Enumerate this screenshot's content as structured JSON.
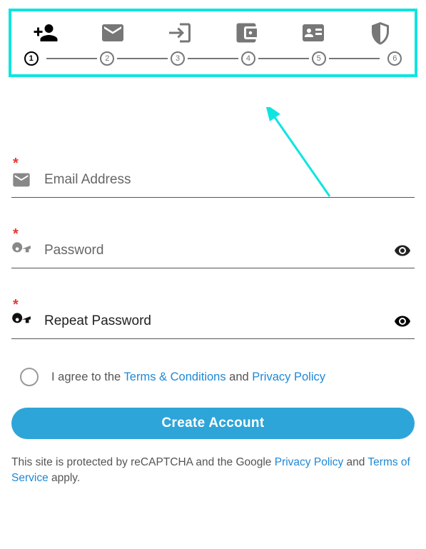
{
  "stepper": {
    "steps": [
      {
        "num": "1",
        "icon": "person-add-icon",
        "active": true
      },
      {
        "num": "2",
        "icon": "mail-icon",
        "active": false
      },
      {
        "num": "3",
        "icon": "login-icon",
        "active": false
      },
      {
        "num": "4",
        "icon": "wallet-icon",
        "active": false
      },
      {
        "num": "5",
        "icon": "id-card-icon",
        "active": false
      },
      {
        "num": "6",
        "icon": "shield-icon",
        "active": false
      }
    ]
  },
  "form": {
    "email_placeholder": "Email Address",
    "password_placeholder": "Password",
    "repeat_password_placeholder": "Repeat Password",
    "required_mark": "*",
    "agree_prefix": "I agree to the ",
    "terms_label": "Terms & Conditions",
    "agree_middle": " and ",
    "privacy_label": "Privacy Policy",
    "create_label": "Create Account"
  },
  "recaptcha": {
    "prefix": "This site is protected by reCAPTCHA and the Google ",
    "privacy": "Privacy Policy",
    "middle": " and ",
    "terms": "Terms of Service",
    "suffix": " apply."
  }
}
